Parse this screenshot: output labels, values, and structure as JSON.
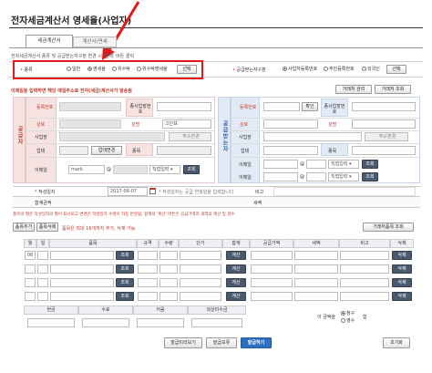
{
  "page": {
    "title": "전자세금계산서 영세율(사업자)"
  },
  "tabs": [
    "세금계산서",
    "계산서(면세"
  ],
  "notice": "전자세금계산서 종류 및 공급받는자구분 변경 시 '선택' 버튼 클릭",
  "kind": {
    "label": "종류",
    "options": [
      "일반",
      "영세율",
      "위수탁",
      "위수탁영세율"
    ],
    "selected": 1,
    "select_btn": "선택"
  },
  "recipient": {
    "label": "공급받는자구분",
    "options": [
      "사업자등록번호",
      "주민등록번호",
      "외국인"
    ],
    "selected": 0,
    "select_btn": "선택"
  },
  "email_notice": "이메일을 입력하면 해당 메일주소로 전자(세금)계산서가 발송됨",
  "toolbar": {
    "manage": "거래처 관리",
    "lookup": "거래처 조회"
  },
  "supplier": {
    "section": "공급자",
    "reg_no": "등록번호",
    "sub_no": "종사업장번호",
    "name": "상호",
    "rep": "성명",
    "rep_value": "고민표",
    "address": "사업장",
    "addr_btn": "주소변경",
    "biz": "업태",
    "biz_btn": "업태변경",
    "item": "종목",
    "email": "이메일",
    "email_user": "mark",
    "email_domain": "직접입력",
    "search": "조회"
  },
  "buyer": {
    "section": "공급받는자",
    "reg_no": "등록번호",
    "confirm": "확인",
    "sub_no": "종사업장번호",
    "name": "상호",
    "rep": "성명",
    "address": "사업장",
    "addr_btn": "주소변경",
    "biz": "업태",
    "item": "종목",
    "email": "이메일",
    "email_domain": "직접입력",
    "search": "조회"
  },
  "date": {
    "label": "작성일자",
    "value": "2017-06-07",
    "hint": "작성일자는 공급 연월일을 입력합니다",
    "remark": "비고"
  },
  "totals": {
    "supply": "합계금액",
    "tax": "세액"
  },
  "warning": "품목의 월은 작성일자의 월이 표시되고 변경은 작성일자 수정이 자동 반영됨, 합계의 '계산' 버튼은 공급가액과 세액의 계산 및 검수",
  "items_bar": {
    "add": "품목추가",
    "delete": "품목삭제",
    "hint": "품목은 최대 16개까지 추가, 삭제 가능",
    "lookup": "거래처품목 조회"
  },
  "item_table": {
    "headers": [
      "월",
      "일",
      "품목",
      "규격",
      "수량",
      "단가",
      "합계",
      "공급가액",
      "세액",
      "비고",
      "삭제"
    ],
    "first_month": "06",
    "search_btn": "조회",
    "calc_btn": "계산",
    "delete_btn": "삭제"
  },
  "payment": {
    "headers": [
      "현금",
      "수표",
      "어음",
      "외상미수금"
    ],
    "amount_prefix": "이 금액을",
    "claim": "청구",
    "receipt": "영수",
    "suffix": "함"
  },
  "actions": {
    "preview": "발급미리보기",
    "hold": "발급보류",
    "issue": "발급하기",
    "reset": "초기화"
  }
}
